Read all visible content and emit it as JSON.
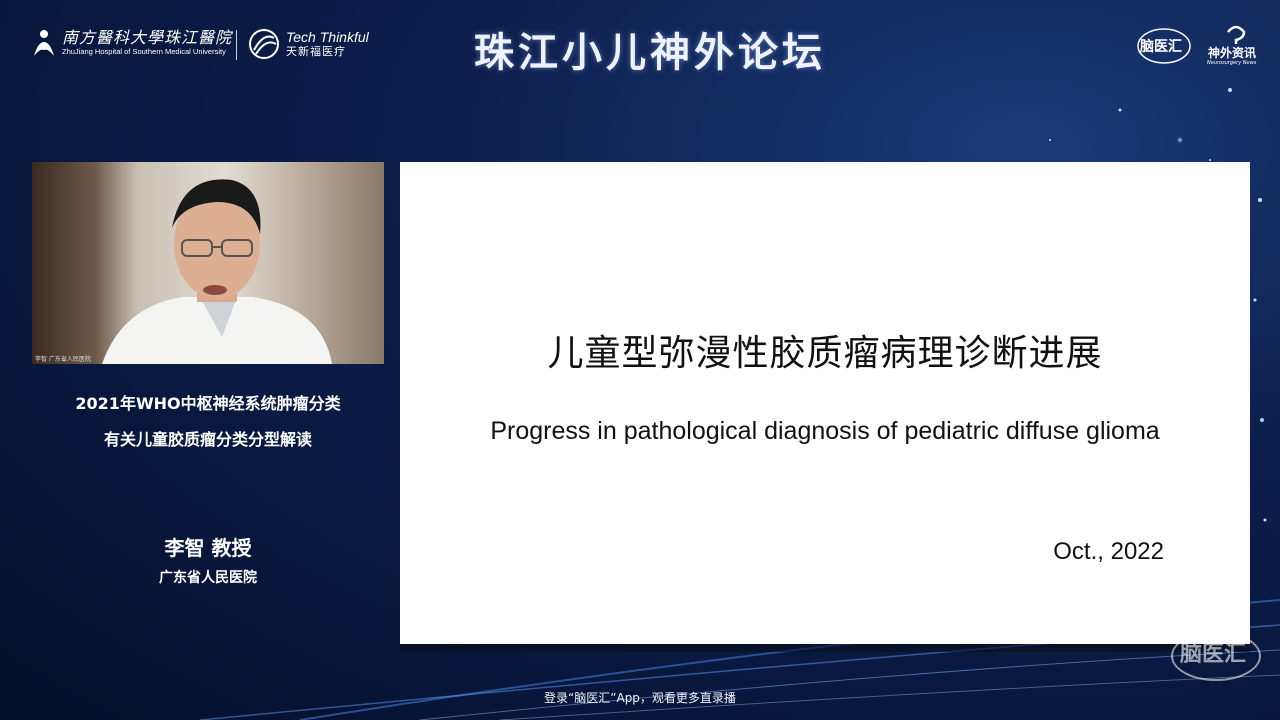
{
  "header": {
    "hospital_logo_cn": "南方醫科大學珠江醫院",
    "hospital_logo_en": "ZhuJiang Hospital of Southern Medical University",
    "sponsor_logo_en": "Tech Thinkful",
    "sponsor_logo_cn": "天新福医疗",
    "title": "珠江小儿神外论坛",
    "brand1": "脑医汇",
    "brand2": "神外资讯",
    "brand2_sub": "Neurosurgery News"
  },
  "video": {
    "caption": "李智 广东省人民医院"
  },
  "info": {
    "title_line1": "2021年WHO中枢神经系统肿瘤分类",
    "title_line2": "有关儿童胶质瘤分类分型解读",
    "speaker": "李智 教授",
    "hospital": "广东省人民医院"
  },
  "slide": {
    "title_cn": "儿童型弥漫性胶质瘤病理诊断进展",
    "title_en": "Progress in pathological diagnosis of pediatric diffuse glioma",
    "date": "Oct., 2022"
  },
  "footer": {
    "text": "登录“脑医汇”App，观看更多直录播",
    "watermark": "脑医汇"
  }
}
